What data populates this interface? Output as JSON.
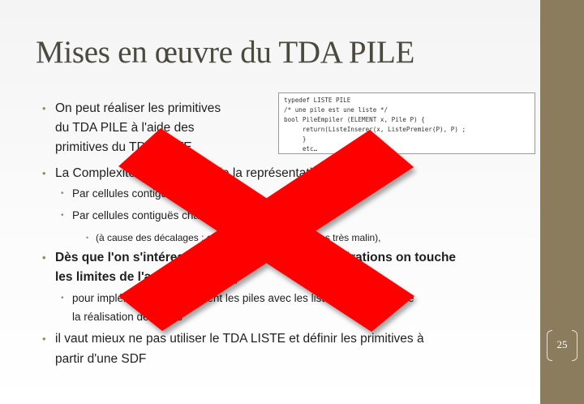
{
  "slide": {
    "title": "Mises en œuvre du TDA PILE",
    "page_number": "25",
    "code": [
      "typedef LISTE PILE",
      "/* une pile est une liste */",
      "bool PileEmpiler (ELEMENT x, Pile P) {",
      "     return(ListeInserer(x, ListePremier(P), P) ;",
      "     }",
      "     etc…"
    ],
    "bullets": {
      "b1_l1": "On peut réaliser les primitives",
      "b1_l2": "du TDA PILE à l'aide des",
      "b1_l3": "primitives du TDA LISTE",
      "b2": "La Complexité dépend alors de la représentation des listes",
      "b2_s1": "Par cellules contiguës",
      "b2_s2": "Par cellules contiguës chaînées",
      "b2_s2_s1": "(à cause des décalages : empiler en tête de liste…pas très malin),",
      "b3_l1": "Dès que l'on s'intéresse aux complexités des opérations on touche",
      "b3_l2": "les limites de l'approche TDA (",
      "b3_s1_l1": "pour implémenter efficacement les piles avec les listes il faut connaître",
      "b3_s1_l2": "la réalisation des listes",
      "b4_l1": "il vaut mieux ne pas utiliser le TDA LISTE et définir les primitives à",
      "b4_l2": "partir d'une SDF"
    },
    "colors": {
      "sidebar": "#8b7c5e",
      "cross": "#ff0000",
      "bullet": "#9b8b62",
      "title": "#4a4a3e"
    },
    "overlay_icon": "red-cross-icon"
  }
}
